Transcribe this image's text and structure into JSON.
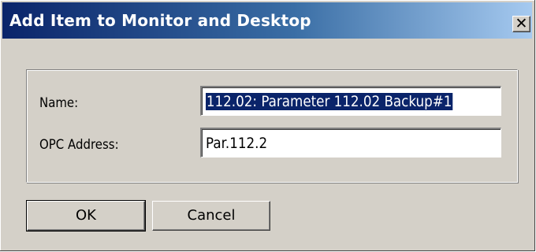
{
  "window": {
    "title": "Add Item to Monitor and Desktop",
    "close_glyph": "✕",
    "titlebar_colors": [
      "#0a246a",
      "#a6caf0"
    ]
  },
  "form": {
    "name_label": "Name:",
    "name_value": "112.02: Parameter 112.02 Backup#1",
    "opc_label": "OPC Address:",
    "opc_value": "Par.112.2"
  },
  "buttons": {
    "ok_label": "OK",
    "cancel_label": "Cancel"
  }
}
